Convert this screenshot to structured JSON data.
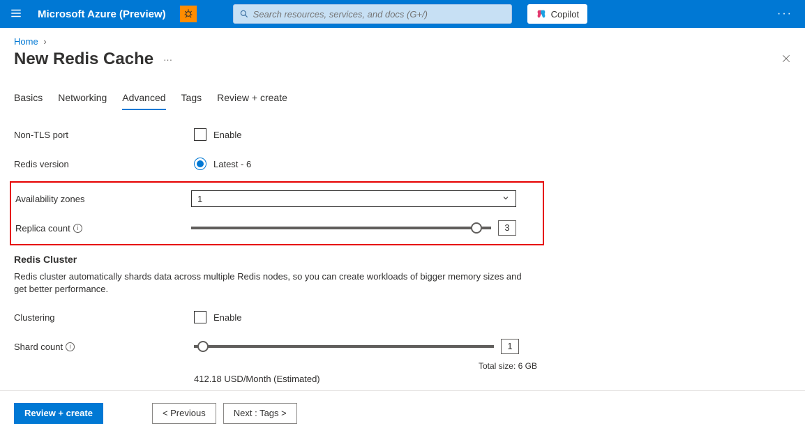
{
  "header": {
    "brand": "Microsoft Azure (Preview)",
    "search_placeholder": "Search resources, services, and docs (G+/)",
    "copilot_label": "Copilot"
  },
  "breadcrumb": {
    "home": "Home"
  },
  "page": {
    "title": "New Redis Cache"
  },
  "tabs": {
    "basics": "Basics",
    "networking": "Networking",
    "advanced": "Advanced",
    "tags": "Tags",
    "review": "Review + create",
    "active": "advanced"
  },
  "form": {
    "non_tls": {
      "label": "Non-TLS port",
      "enable_label": "Enable",
      "checked": false
    },
    "redis_version": {
      "label": "Redis version",
      "option_label": "Latest - 6",
      "selected": true
    },
    "availability_zones": {
      "label": "Availability zones",
      "value": "1"
    },
    "replica_count": {
      "label": "Replica count",
      "value": "3",
      "min": 1,
      "max": 3,
      "percent": 95
    },
    "cluster_section": {
      "title": "Redis Cluster",
      "desc": "Redis cluster automatically shards data across multiple Redis nodes, so you can create workloads of bigger memory sizes and get better performance."
    },
    "clustering": {
      "label": "Clustering",
      "enable_label": "Enable",
      "checked": false
    },
    "shard_count": {
      "label": "Shard count",
      "value": "1",
      "percent": 3,
      "total_size": "Total size: 6 GB"
    },
    "price": "412.18 USD/Month (Estimated)"
  },
  "footer": {
    "review": "Review + create",
    "previous": "< Previous",
    "next": "Next : Tags >"
  }
}
